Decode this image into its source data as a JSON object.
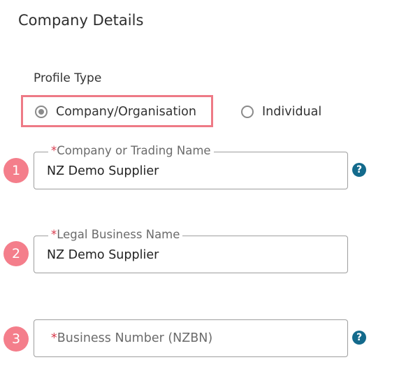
{
  "section": {
    "title": "Company Details"
  },
  "profile_type": {
    "label": "Profile Type",
    "options": [
      {
        "label": "Company/Organisation",
        "selected": true
      },
      {
        "label": "Individual",
        "selected": false
      }
    ],
    "highlight_color": "#ee7a86"
  },
  "fields": [
    {
      "step": "1",
      "required_mark": "*",
      "label": "Company or Trading Name",
      "value": "NZ Demo Supplier",
      "has_help": true
    },
    {
      "step": "2",
      "required_mark": "*",
      "label": "Legal Business Name",
      "value": "NZ Demo Supplier",
      "has_help": false
    },
    {
      "step": "3",
      "required_mark": "*",
      "label": "Business Number (NZBN)",
      "value": "",
      "has_help": true
    }
  ],
  "icons": {
    "help": "question-circle-icon",
    "radio": "radio-button-icon"
  },
  "colors": {
    "badge": "#f47e8b",
    "help": "#136a8c",
    "required": "#d83a4c"
  }
}
